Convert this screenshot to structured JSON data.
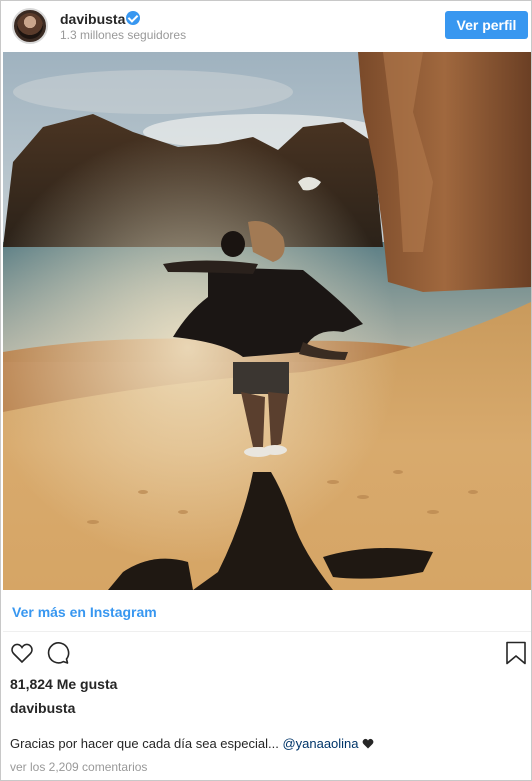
{
  "header": {
    "username": "davibusta",
    "followers": "1.3 millones seguidores",
    "follow_button": "Ver perfil"
  },
  "post": {
    "view_more": "Ver más en Instagram",
    "likes_count": "81,824",
    "likes_label": "Me gusta",
    "owner": "davibusta",
    "caption_text": "Gracias por hacer que cada día sea especial... ",
    "caption_mention": "@yanaaolina",
    "comments_link": "ver los 2,209 comentarios"
  },
  "icons": {
    "verified": "verified-badge-icon",
    "like": "heart-outline-icon",
    "comment": "speech-bubble-icon",
    "save": "bookmark-icon",
    "caption_emoji": "black-heart-icon"
  },
  "colors": {
    "accent": "#3897f0",
    "text": "#262626",
    "muted": "#999999",
    "mention": "#003569"
  }
}
